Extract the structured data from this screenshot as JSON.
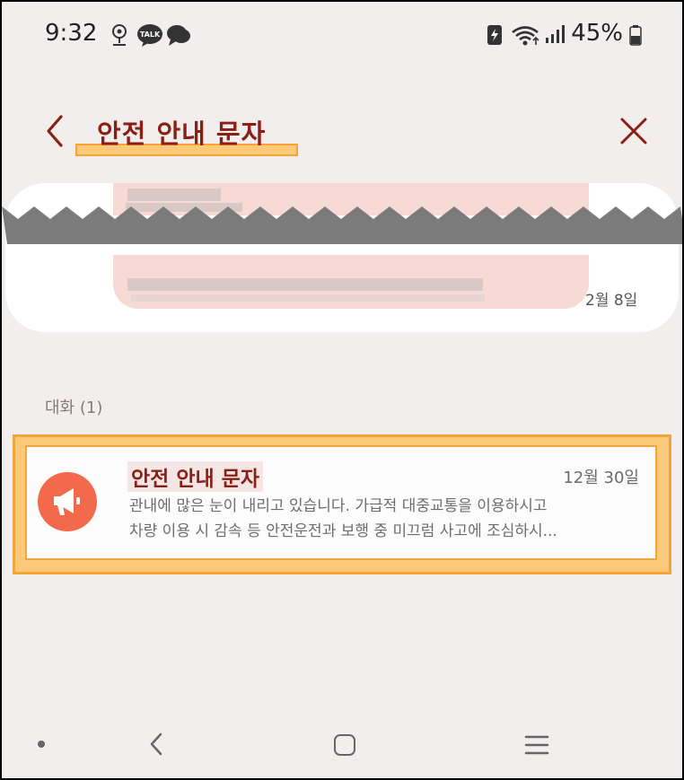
{
  "status_bar": {
    "time": "9:32",
    "kakao_label": "TALK",
    "battery": "45%"
  },
  "header": {
    "title": "안전 안내 문자"
  },
  "redacted_card": {
    "date": "2월 8일"
  },
  "section_label": "대화 (1)",
  "conversation": {
    "title": "안전 안내 문자",
    "date": "12월 30일",
    "preview_line1": "관내에 많은 눈이 내리고 있습니다. 가급적 대중교통을 이용하시고",
    "preview_line2": "차량 이용 시 감속 등 안전운전과 보행 중 미끄럼 사고에 조심하시..."
  },
  "colors": {
    "title": "#8a1f16",
    "highlight": "#fbc978",
    "avatar": "#f26a4b",
    "background": "#f1eeed"
  }
}
